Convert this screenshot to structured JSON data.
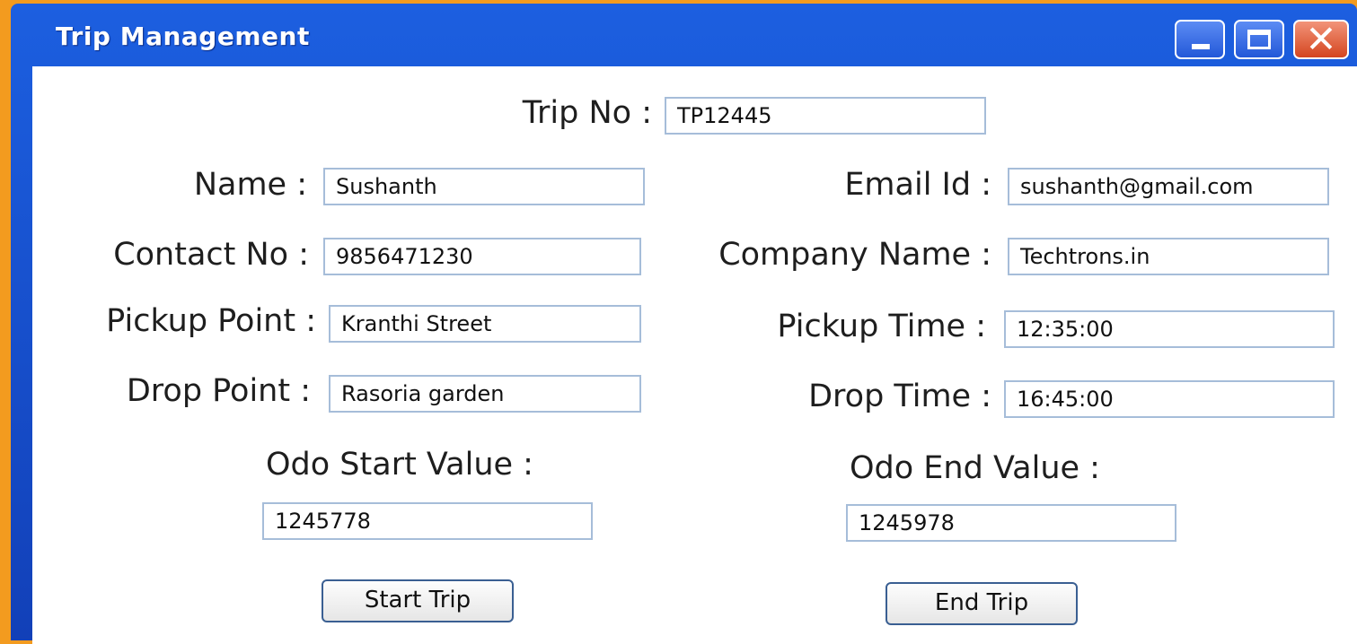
{
  "window": {
    "title": "Trip Management"
  },
  "form": {
    "trip_no": {
      "label": "Trip No :",
      "value": "TP12445"
    },
    "name": {
      "label": "Name :",
      "value": "Sushanth"
    },
    "email": {
      "label": "Email Id :",
      "value": "sushanth@gmail.com"
    },
    "contact": {
      "label": "Contact No :",
      "value": "9856471230"
    },
    "company": {
      "label": "Company Name :",
      "value": "Techtrons.in"
    },
    "pickup_point": {
      "label": "Pickup Point :",
      "value": "Kranthi Street"
    },
    "pickup_time": {
      "label": "Pickup Time :",
      "value": "12:35:00"
    },
    "drop_point": {
      "label": "Drop Point :",
      "value": "Rasoria garden"
    },
    "drop_time": {
      "label": "Drop Time :",
      "value": "16:45:00"
    },
    "odo_start": {
      "label": "Odo Start Value :",
      "value": "1245778"
    },
    "odo_end": {
      "label": "Odo End Value :",
      "value": "1245978"
    }
  },
  "buttons": {
    "start": "Start Trip",
    "end": "End Trip"
  },
  "colors": {
    "titlebar": "#1c5fe0",
    "background": "#f39b1f",
    "close": "#d44520"
  },
  "icons": {
    "minimize": "minimize-icon",
    "maximize": "maximize-icon",
    "close": "close-icon"
  }
}
